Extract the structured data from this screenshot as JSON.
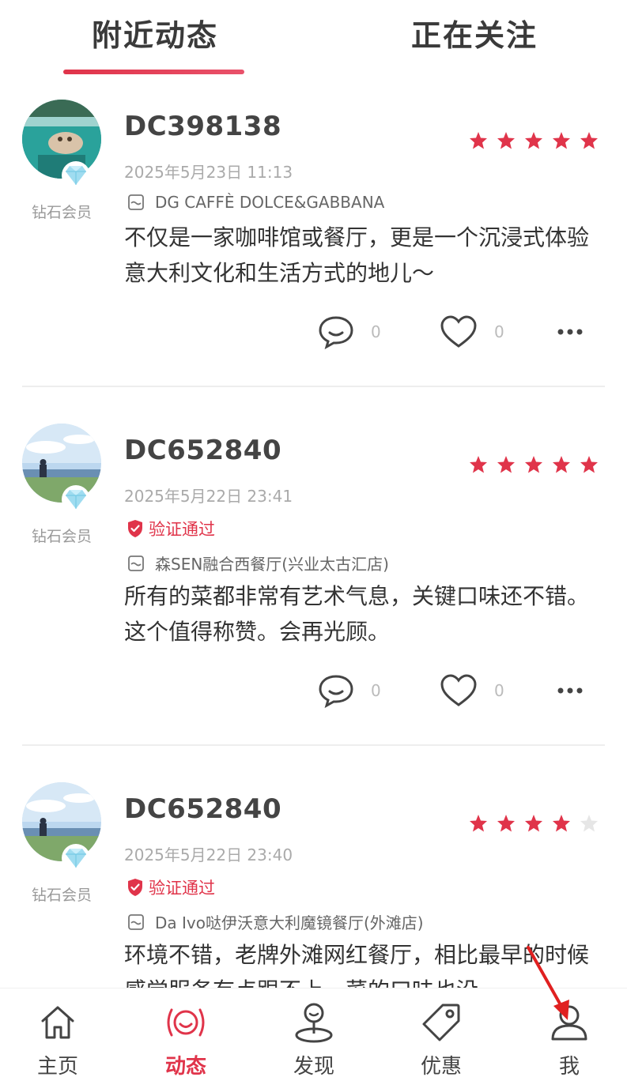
{
  "tabs": {
    "nearby": "附近动态",
    "following": "正在关注"
  },
  "colors": {
    "accent": "#e0344a",
    "star_empty": "#e6e6e6"
  },
  "posts": [
    {
      "username": "DC398138",
      "member": "钻石会员",
      "rating": 5,
      "timestamp": "2025年5月23日 11:13",
      "verified": "",
      "venue": "DG CAFFÈ DOLCE&GABBANA",
      "content": "不仅是一家咖啡馆或餐厅，更是一个沉浸式体验意大利文化和生活方式的地儿～",
      "comments": "0",
      "likes": "0"
    },
    {
      "username": "DC652840",
      "member": "钻石会员",
      "rating": 5,
      "timestamp": "2025年5月22日 23:41",
      "verified": "验证通过",
      "venue": "森SEN融合西餐厅(兴业太古汇店)",
      "content": "所有的菜都非常有艺术气息，关键口味还不错。这个值得称赞。会再光顾。",
      "comments": "0",
      "likes": "0"
    },
    {
      "username": "DC652840",
      "member": "钻石会员",
      "rating": 4,
      "timestamp": "2025年5月22日 23:40",
      "verified": "验证通过",
      "venue": "Da Ivo哒伊沃意大利魔镜餐厅(外滩店)",
      "content": "环境不错，老牌外滩网红餐厅，相比最早的时候感觉服务有点跟不上，菜的口味也没",
      "comments": "",
      "likes": ""
    }
  ],
  "nav": [
    {
      "label": "主页",
      "icon": "home-icon"
    },
    {
      "label": "动态",
      "icon": "feed-icon"
    },
    {
      "label": "发现",
      "icon": "discover-icon"
    },
    {
      "label": "优惠",
      "icon": "tag-icon"
    },
    {
      "label": "我",
      "icon": "profile-icon"
    }
  ]
}
